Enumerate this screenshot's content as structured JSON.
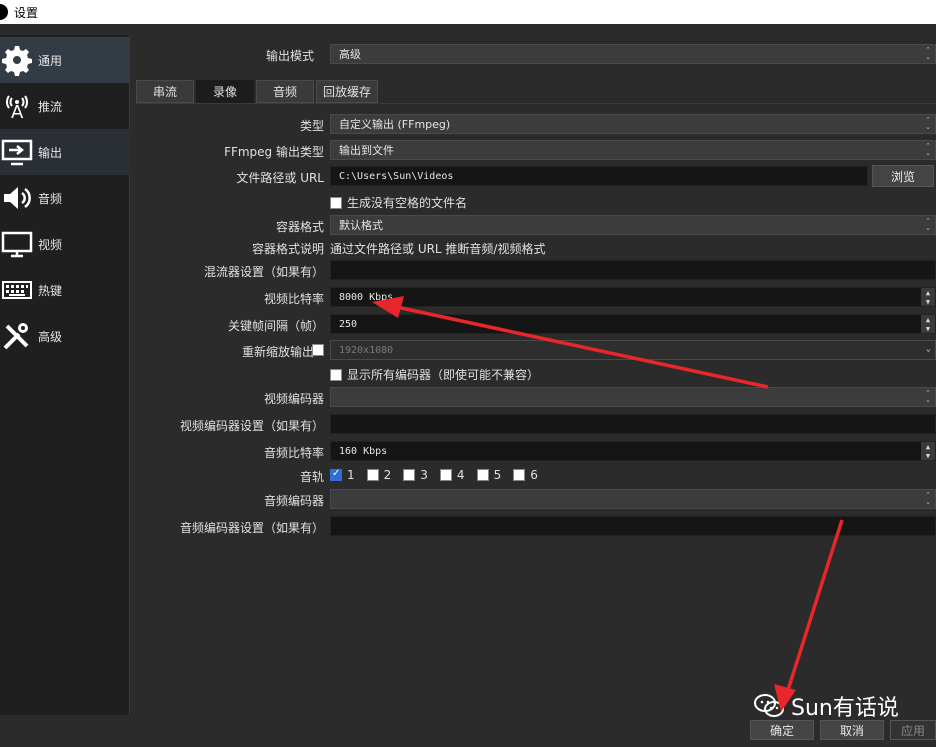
{
  "window": {
    "title": "设置"
  },
  "sidebar": {
    "items": [
      {
        "label": "通用",
        "icon": "gear-icon"
      },
      {
        "label": "推流",
        "icon": "broadcast-icon"
      },
      {
        "label": "输出",
        "icon": "monitor-output-icon"
      },
      {
        "label": "音频",
        "icon": "speaker-icon"
      },
      {
        "label": "视频",
        "icon": "monitor-icon"
      },
      {
        "label": "热键",
        "icon": "keyboard-icon"
      },
      {
        "label": "高级",
        "icon": "tools-icon"
      }
    ],
    "active": "输出"
  },
  "output_mode": {
    "label": "输出模式",
    "value": "高级"
  },
  "tabs": [
    "串流",
    "录像",
    "音频",
    "回放缓存"
  ],
  "active_tab": "录像",
  "recording": {
    "type": {
      "label": "类型",
      "value": "自定义输出 (FFmpeg)"
    },
    "ffmpeg_output_type": {
      "label": "FFmpeg 输出类型",
      "value": "输出到文件"
    },
    "file_path": {
      "label": "文件路径或 URL",
      "value": "C:\\Users\\Sun\\Videos",
      "browse": "浏览"
    },
    "no_space_filename": {
      "label": "生成没有空格的文件名",
      "checked": false
    },
    "container_format": {
      "label": "容器格式",
      "value": "默认格式"
    },
    "container_desc": {
      "label": "容器格式说明",
      "value": "通过文件路径或 URL 推断音频/视频格式"
    },
    "muxer_settings": {
      "label": "混流器设置（如果有）",
      "value": ""
    },
    "video_bitrate": {
      "label": "视频比特率",
      "value": "8000 Kbps"
    },
    "keyframe_interval": {
      "label": "关键帧间隔（帧）",
      "value": "250"
    },
    "rescale_output": {
      "label": "重新缩放输出",
      "checked": false,
      "value": "1920x1080"
    },
    "show_all_encoders": {
      "label": "显示所有编码器（即使可能不兼容）",
      "checked": false
    },
    "video_encoder": {
      "label": "视频编码器",
      "value": ""
    },
    "video_encoder_settings": {
      "label": "视频编码器设置（如果有）",
      "value": ""
    },
    "audio_bitrate": {
      "label": "音频比特率",
      "value": "160 Kbps"
    },
    "audio_tracks": {
      "label": "音轨",
      "tracks": [
        {
          "num": "1",
          "checked": true
        },
        {
          "num": "2",
          "checked": false
        },
        {
          "num": "3",
          "checked": false
        },
        {
          "num": "4",
          "checked": false
        },
        {
          "num": "5",
          "checked": false
        },
        {
          "num": "6",
          "checked": false
        }
      ]
    },
    "audio_encoder": {
      "label": "音频编码器",
      "value": ""
    },
    "audio_encoder_settings": {
      "label": "音频编码器设置（如果有）",
      "value": ""
    }
  },
  "footer": {
    "ok": "确定",
    "cancel": "取消",
    "apply": "应用"
  },
  "watermark": {
    "text": "Sun有话说",
    "icon": "wechat-icon"
  },
  "colors": {
    "accent": "#2d6fd6",
    "annotation_arrow": "#e8262b"
  }
}
